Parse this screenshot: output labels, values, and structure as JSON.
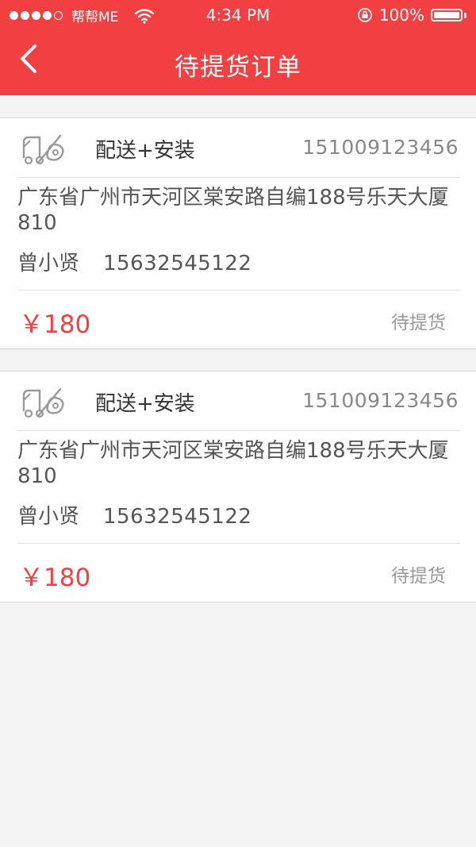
{
  "status_bar": {
    "carrier": "帮帮ME",
    "time": "4:34 PM",
    "battery": "100%",
    "battery_level": 1.0,
    "signal_dots_filled": 4,
    "signal_dots_total": 5
  },
  "nav": {
    "title": "待提货订单",
    "back_icon": "chevron-left-icon"
  },
  "colors": {
    "brand": "#f23f42",
    "background": "#f3f3f3"
  },
  "orders": [
    {
      "service": "配送+安装",
      "order_no": "151009123456",
      "address": "广东省广州市天河区棠安路自编188号乐天大厦810",
      "name": "曾小贤",
      "phone": "15632545122",
      "price": "￥180",
      "status": "待提货",
      "icon": "delivery-install-icon"
    },
    {
      "service": "配送+安装",
      "order_no": "151009123456",
      "address": "广东省广州市天河区棠安路自编188号乐天大厦810",
      "name": "曾小贤",
      "phone": "15632545122",
      "price": "￥180",
      "status": "待提货",
      "icon": "delivery-install-icon"
    }
  ]
}
